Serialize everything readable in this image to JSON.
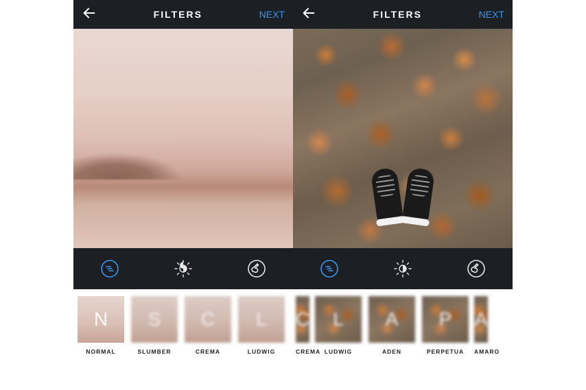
{
  "screens": {
    "left": {
      "header": {
        "title": "FILTERS",
        "next": "NEXT"
      },
      "filters": [
        {
          "letter": "N",
          "label": "NORMAL"
        },
        {
          "letter": "S",
          "label": "SLUMBER"
        },
        {
          "letter": "C",
          "label": "CREMA"
        },
        {
          "letter": "L",
          "label": "LUDWIG"
        }
      ]
    },
    "right": {
      "header": {
        "title": "FILTERS",
        "next": "NEXT"
      },
      "filters": [
        {
          "letter": "C",
          "label": "CREMA"
        },
        {
          "letter": "L",
          "label": "LUDWIG"
        },
        {
          "letter": "A",
          "label": "ADEN"
        },
        {
          "letter": "P",
          "label": "PERPETUA"
        },
        {
          "letter": "A",
          "label": "AMARO"
        }
      ]
    }
  },
  "tools": {
    "filter_icon": "filter-icon",
    "lux_icon": "lux-icon",
    "edit_icon": "edit-icon"
  },
  "colors": {
    "accent": "#3897f0",
    "header_bg": "#1c1f23"
  }
}
